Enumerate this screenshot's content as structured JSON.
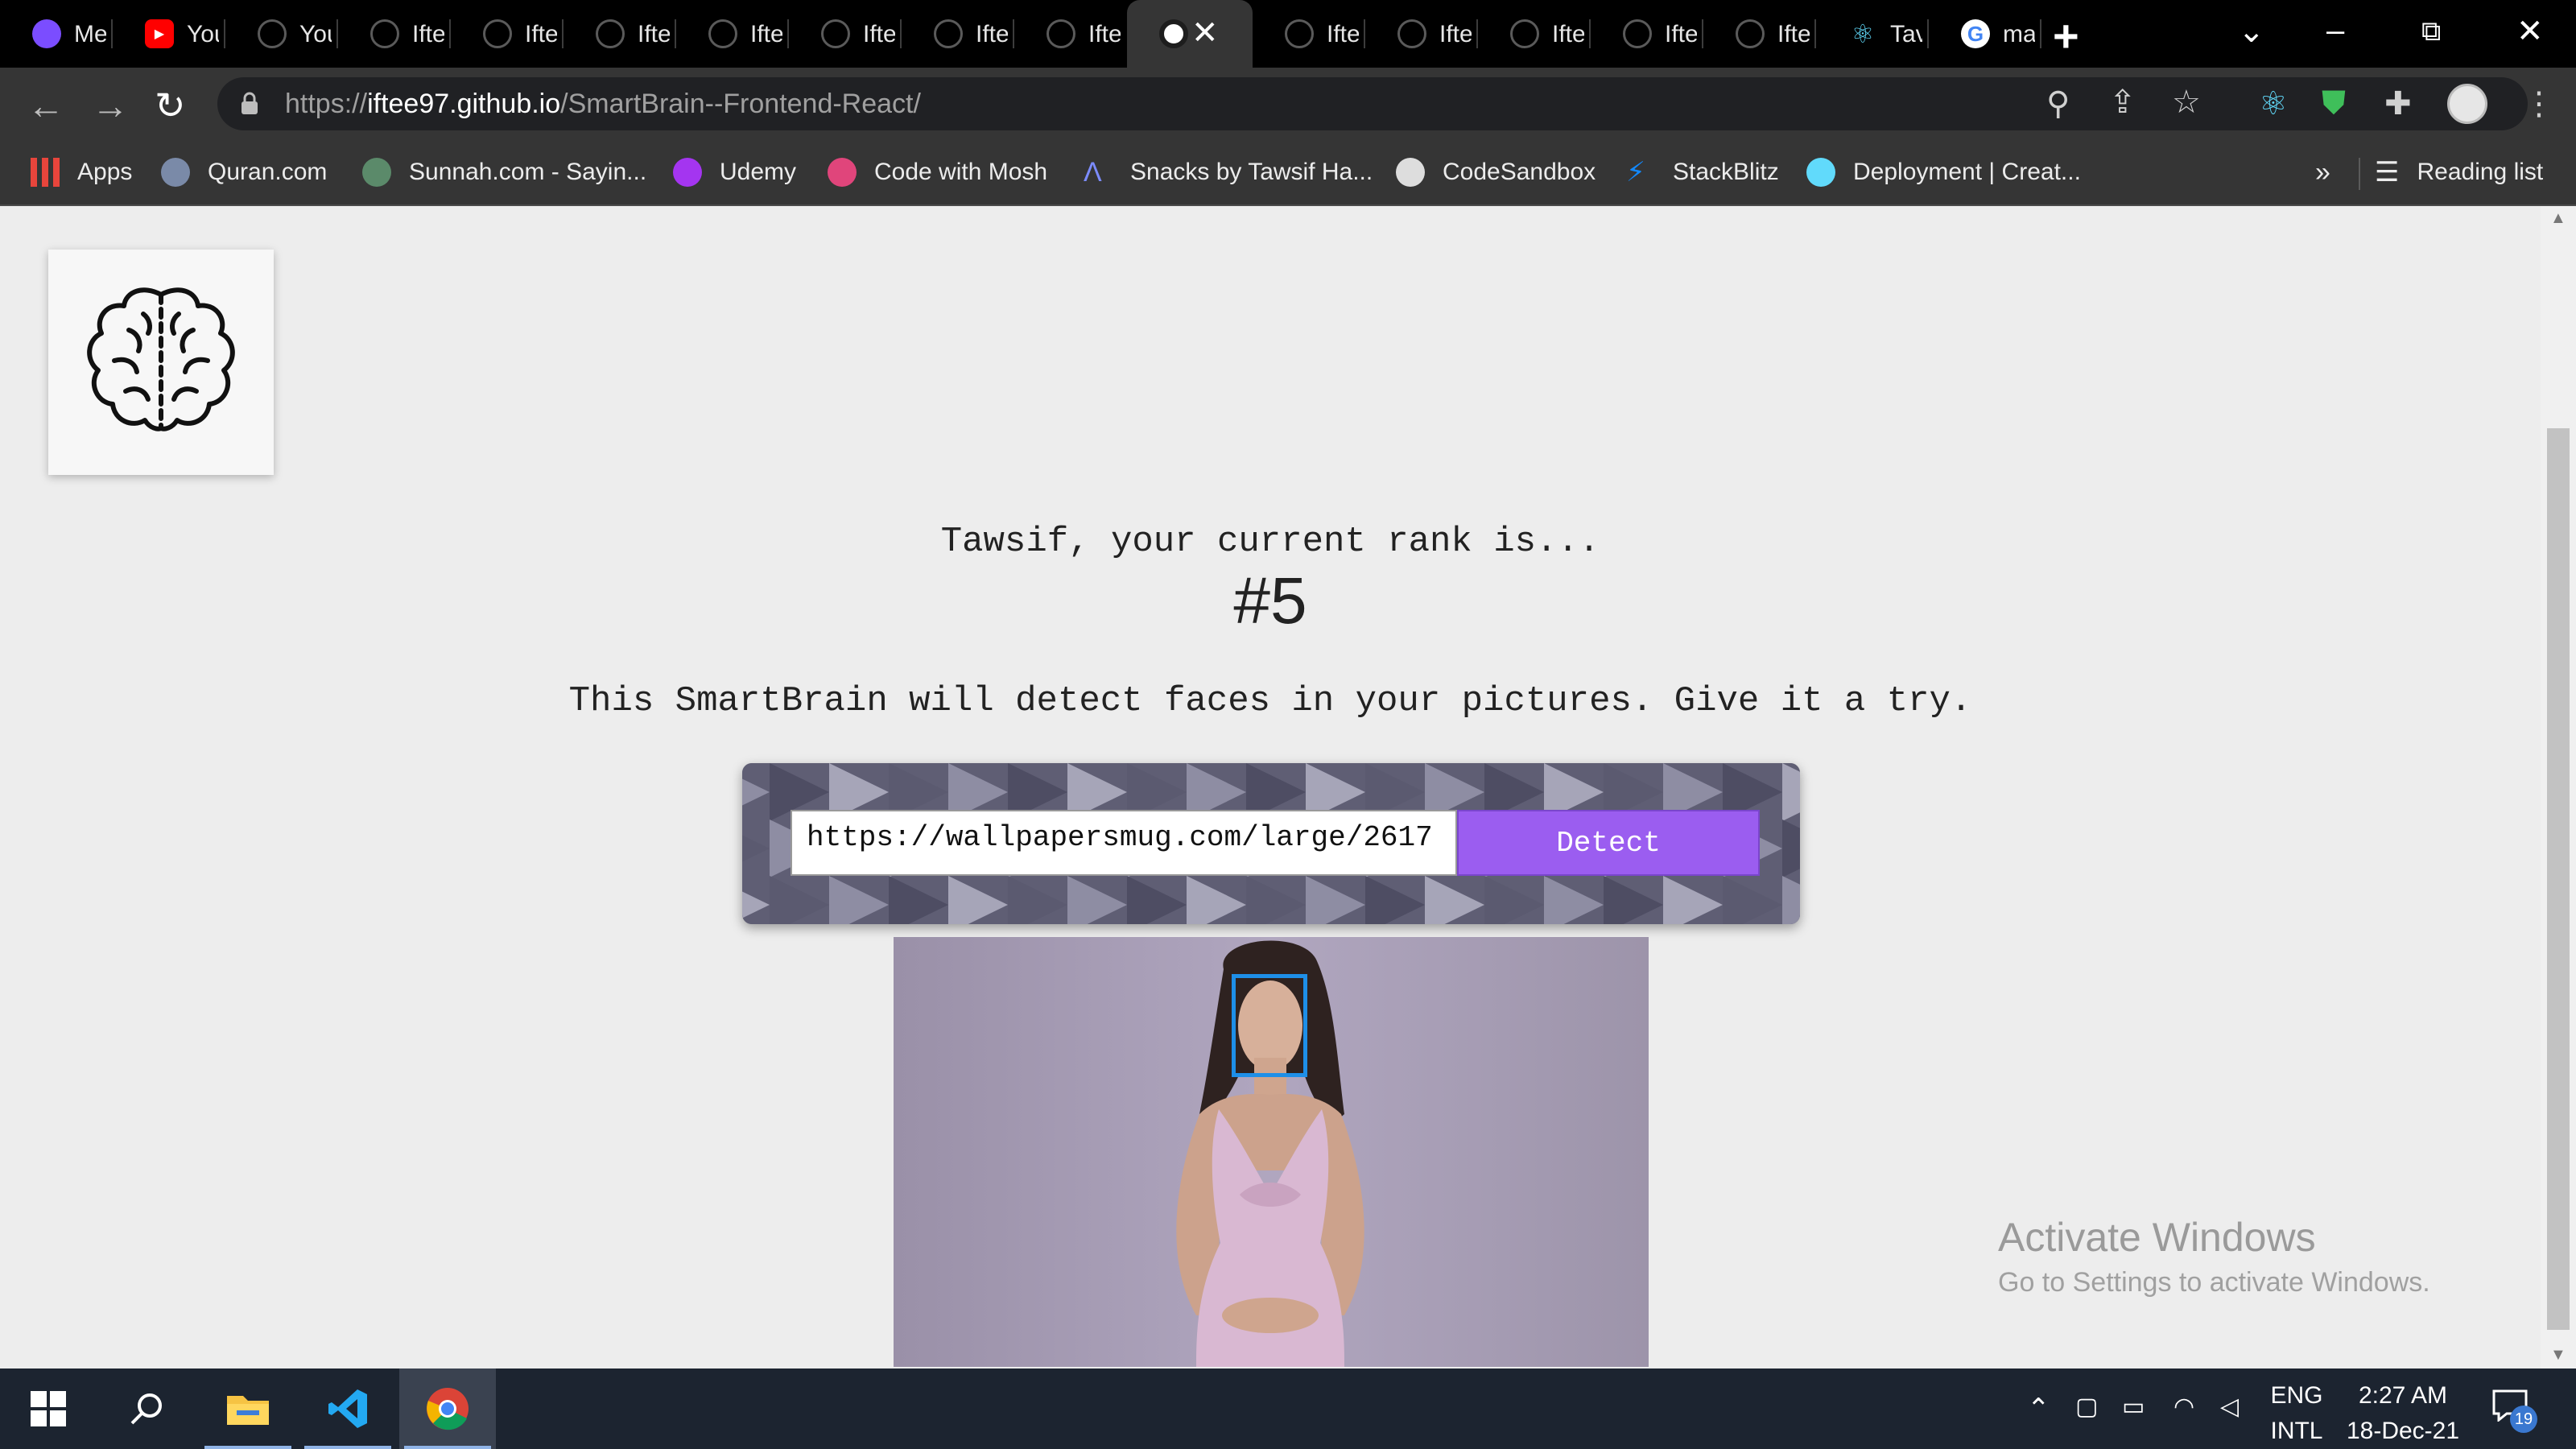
{
  "browser": {
    "tabs": [
      {
        "label": "Me",
        "icon": "messenger-icon",
        "color": "#7b4dff"
      },
      {
        "label": "You",
        "icon": "youtube-icon",
        "color": "#ff0000"
      },
      {
        "label": "You",
        "icon": "github-icon",
        "color": "#2b2b2b"
      },
      {
        "label": "Ifte",
        "icon": "github-icon",
        "color": "#2b2b2b"
      },
      {
        "label": "Ifte",
        "icon": "github-icon",
        "color": "#2b2b2b"
      },
      {
        "label": "Ifte",
        "icon": "github-icon",
        "color": "#2b2b2b"
      },
      {
        "label": "Ifte",
        "icon": "github-icon",
        "color": "#2b2b2b"
      },
      {
        "label": "Ifte",
        "icon": "github-icon",
        "color": "#2b2b2b"
      },
      {
        "label": "Ifte",
        "icon": "github-icon",
        "color": "#2b2b2b"
      },
      {
        "label": "Ifte",
        "icon": "github-icon",
        "color": "#2b2b2b"
      },
      {
        "label": "",
        "icon": "globe-icon",
        "color": "#ffffff",
        "active": true
      },
      {
        "label": "Ifte",
        "icon": "github-icon",
        "color": "#2b2b2b"
      },
      {
        "label": "Ifte",
        "icon": "github-icon",
        "color": "#2b2b2b"
      },
      {
        "label": "Ifte",
        "icon": "github-icon",
        "color": "#2b2b2b"
      },
      {
        "label": "Ifte",
        "icon": "github-icon",
        "color": "#2b2b2b"
      },
      {
        "label": "Ifte",
        "icon": "github-icon",
        "color": "#2b2b2b"
      },
      {
        "label": "Tav",
        "icon": "react-icon",
        "color": "#61dafb"
      },
      {
        "label": "ma",
        "icon": "google-icon",
        "color": "#ffffff"
      }
    ],
    "url_scheme": "https://",
    "url_host": "iftee97.github.io",
    "url_path": "/SmartBrain--Frontend-React/",
    "bookmarks": [
      {
        "label": "Apps",
        "icon": "apps-grid-icon",
        "color": "#e8453c"
      },
      {
        "label": "Quran.com",
        "icon": "quran-icon",
        "color": "#7a8aa8"
      },
      {
        "label": "Sunnah.com - Sayin...",
        "icon": "sunnah-icon",
        "color": "#5b8a6a"
      },
      {
        "label": "Udemy",
        "icon": "udemy-icon",
        "color": "#a435f0"
      },
      {
        "label": "Code with Mosh",
        "icon": "mosh-icon",
        "color": "#e0457b"
      },
      {
        "label": "Snacks by Tawsif Ha...",
        "icon": "snacks-icon",
        "color": "#3b5bdb"
      },
      {
        "label": "CodeSandbox",
        "icon": "codesandbox-icon",
        "color": "#dddddd"
      },
      {
        "label": "StackBlitz",
        "icon": "stackblitz-icon",
        "color": "#1389fd"
      },
      {
        "label": "Deployment | Creat...",
        "icon": "react-icon",
        "color": "#61dafb"
      }
    ],
    "more_bookmarks": "»",
    "reading_list": "Reading list"
  },
  "page": {
    "rank_text": "Tawsif, your current rank is...",
    "rank_number": "#5",
    "tagline": "This SmartBrain will detect faces in your pictures. Give it a try.",
    "input_value": "https://wallpapersmug.com/large/2617",
    "detect_label": "Detect",
    "accent": "#9b5df0",
    "face_box_color": "#1e8fe8"
  },
  "watermark": {
    "title": "Activate Windows",
    "subtitle": "Go to Settings to activate Windows."
  },
  "taskbar": {
    "lang_top": "ENG",
    "lang_bottom": "INTL",
    "time": "2:27 AM",
    "date": "18-Dec-21",
    "notifications": "19"
  }
}
